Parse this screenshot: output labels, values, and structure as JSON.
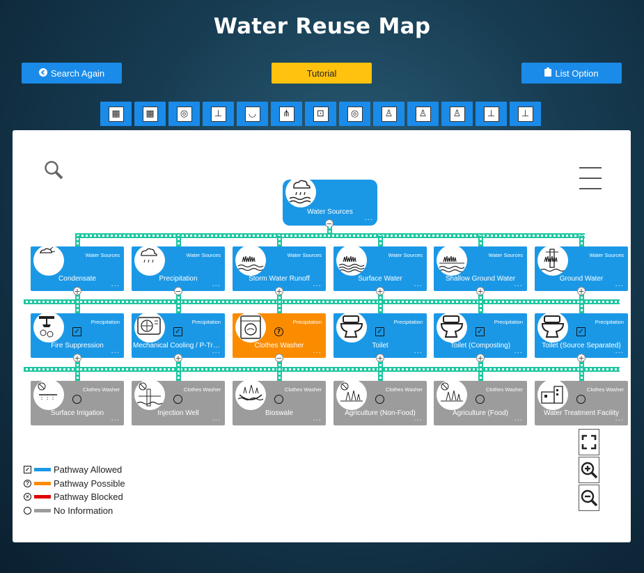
{
  "page": {
    "title": "Water Reuse Map"
  },
  "header_buttons": {
    "search_again": "Search Again",
    "tutorial": "Tutorial",
    "list_option": "List Option"
  },
  "filters": [
    {
      "icon": "building-grid-icon"
    },
    {
      "icon": "building-grid-icon"
    },
    {
      "icon": "washer-icon"
    },
    {
      "icon": "sink-icon"
    },
    {
      "icon": "bathtub-icon"
    },
    {
      "icon": "shower-icon"
    },
    {
      "icon": "dishwasher-icon"
    },
    {
      "icon": "washer-icon"
    },
    {
      "icon": "toilet-icon"
    },
    {
      "icon": "toilet-icon"
    },
    {
      "icon": "toilet-icon"
    },
    {
      "icon": "sink-icon"
    },
    {
      "icon": "sink-icon"
    }
  ],
  "root": {
    "label": "Water Sources",
    "icon": "rain-cloud-icon",
    "dots": "···"
  },
  "row1": [
    {
      "category": "Water Sources",
      "label": "Condensate",
      "icon": "condensate-icon",
      "status": "allowed"
    },
    {
      "category": "Water Sources",
      "label": "Precipitation",
      "icon": "rain-cloud-icon",
      "status": "allowed"
    },
    {
      "category": "Water Sources",
      "label": "Storm Water Runoff",
      "icon": "runoff-icon",
      "status": "allowed"
    },
    {
      "category": "Water Sources",
      "label": "Surface Water",
      "icon": "surface-water-icon",
      "status": "allowed"
    },
    {
      "category": "Water Sources",
      "label": "Shallow Ground Water",
      "icon": "shallow-ground-water-icon",
      "status": "allowed"
    },
    {
      "category": "Water Sources",
      "label": "Ground Water",
      "icon": "well-icon",
      "status": "allowed"
    }
  ],
  "row2": [
    {
      "category": "Precipitation",
      "label": "Fire Suppression",
      "icon": "sprinkler-icon",
      "status": "allowed"
    },
    {
      "category": "Precipitation",
      "label": "Mechanical Cooling / P-Trap Primer",
      "icon": "cooling-unit-icon",
      "status": "allowed"
    },
    {
      "category": "Precipitation",
      "label": "Clothes Washer",
      "icon": "washer-icon",
      "status": "possible"
    },
    {
      "category": "Precipitation",
      "label": "Toilet",
      "icon": "toilet-icon",
      "status": "allowed"
    },
    {
      "category": "Precipitation",
      "label": "Toilet (Composting)",
      "icon": "toilet-icon",
      "status": "allowed"
    },
    {
      "category": "Precipitation",
      "label": "Toilet (Source Separated)",
      "icon": "toilet-icon",
      "status": "allowed"
    }
  ],
  "row3": [
    {
      "category": "Clothes Washer",
      "label": "Surface Irrigation",
      "icon": "irrigation-icon",
      "status": "noinfo"
    },
    {
      "category": "Clothes Washer",
      "label": "Injection Well",
      "icon": "injection-well-icon",
      "status": "noinfo"
    },
    {
      "category": "Clothes Washer",
      "label": "Bioswale",
      "icon": "bioswale-icon",
      "status": "noinfo"
    },
    {
      "category": "Clothes Washer",
      "label": "Agriculture (Non-Food)",
      "icon": "plants-icon",
      "status": "noinfo"
    },
    {
      "category": "Clothes Washer",
      "label": "Agriculture (Food)",
      "icon": "plants-icon",
      "status": "noinfo"
    },
    {
      "category": "Clothes Washer",
      "label": "Water Treatment Facility",
      "icon": "treatment-facility-icon",
      "status": "noinfo"
    }
  ],
  "legend": [
    {
      "symbol": "✓",
      "shape": "square",
      "color": "#1a98e6",
      "label": "Pathway Allowed"
    },
    {
      "symbol": "?",
      "shape": "circle",
      "color": "#fb8c00",
      "label": "Pathway Possible"
    },
    {
      "symbol": "×",
      "shape": "circle",
      "color": "#e00000",
      "label": "Pathway Blocked"
    },
    {
      "symbol": "",
      "shape": "circle",
      "color": "#9c9c9c",
      "label": "No Information"
    }
  ],
  "colors": {
    "allowed": "#1a98e6",
    "possible": "#fb8c00",
    "blocked": "#e00000",
    "noinfo": "#9c9c9c",
    "connector": "#1ec6a0"
  }
}
